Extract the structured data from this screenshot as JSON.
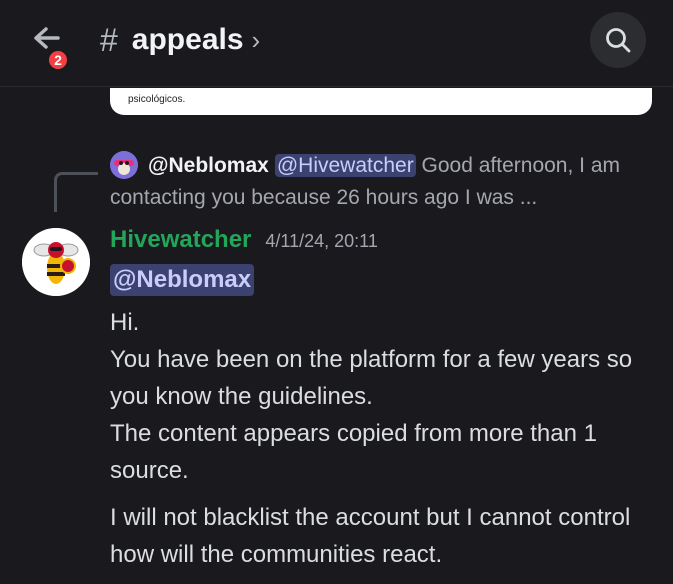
{
  "header": {
    "back_icon": "arrow-left-icon",
    "badge_count": "2",
    "hash": "#",
    "channel_name": "appeals",
    "chevron": "›",
    "search_icon": "search-icon"
  },
  "embed": {
    "text": "psicológicos."
  },
  "reply": {
    "author": "@Neblomax",
    "mention": "@Hivewatcher",
    "text": "Good afternoon, I am contacting you because 26 hours ago I was ..."
  },
  "message": {
    "username": "Hivewatcher",
    "timestamp": "4/11/24, 20:11",
    "mention": "@Neblomax",
    "lines": [
      "Hi.",
      "You have been on the platform for a few years so you know the guidelines.",
      "The content appears copied from more than 1 source.",
      "I will not blacklist the account but I cannot control how will the communities react."
    ]
  },
  "colors": {
    "background": "#1a1a1e",
    "username": "#23a55a",
    "mention_bg": "#3c4270",
    "badge": "#f23f43"
  }
}
